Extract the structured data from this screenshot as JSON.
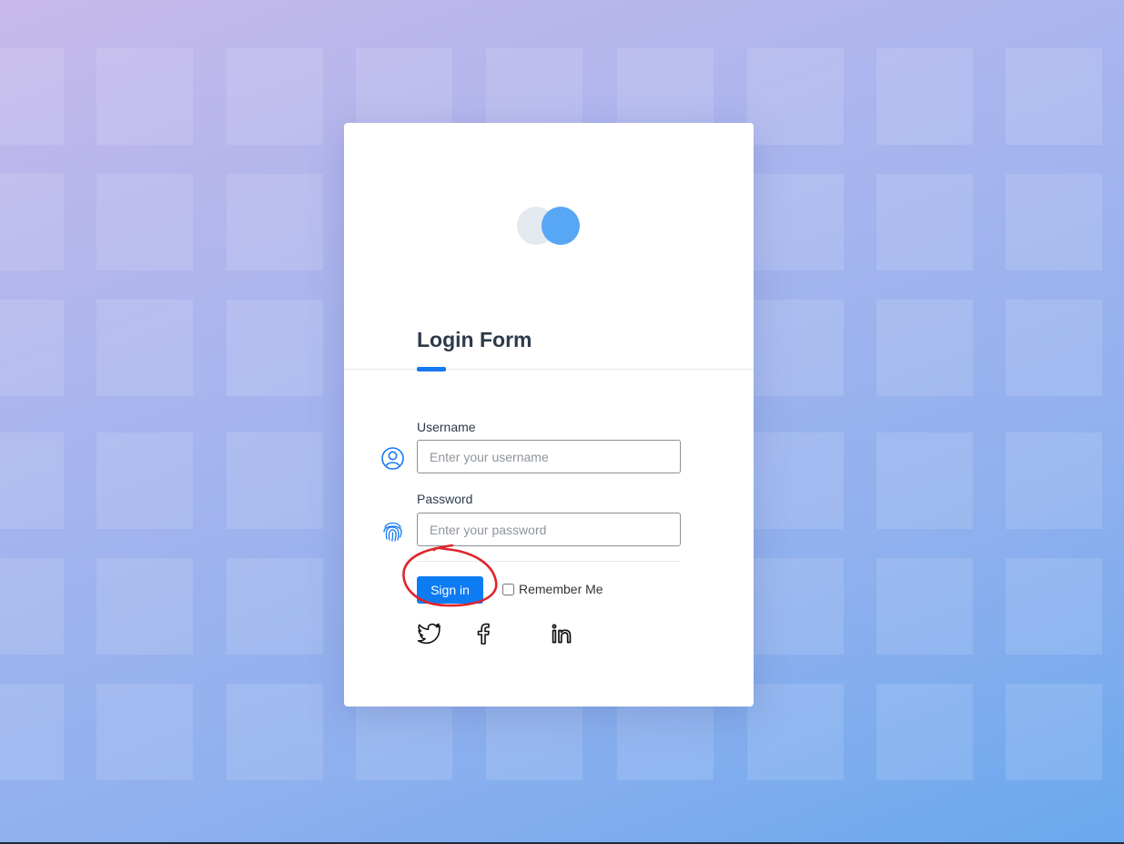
{
  "form": {
    "title": "Login Form",
    "username": {
      "label": "Username",
      "placeholder": "Enter your username",
      "value": "",
      "icon": "user-circle-icon"
    },
    "password": {
      "label": "Password",
      "placeholder": "Enter your password",
      "value": "",
      "icon": "fingerprint-icon"
    },
    "submit_label": "Sign in",
    "remember_label": "Remember Me",
    "remember_checked": false
  },
  "social": [
    "twitter-icon",
    "facebook-icon",
    "linkedin-icon"
  ],
  "colors": {
    "accent": "#0d7bf2",
    "logo_primary": "#58a7f4",
    "logo_secondary": "#e4e9f0",
    "title_text": "#2d3a4b",
    "annotation": "#e0242b"
  }
}
